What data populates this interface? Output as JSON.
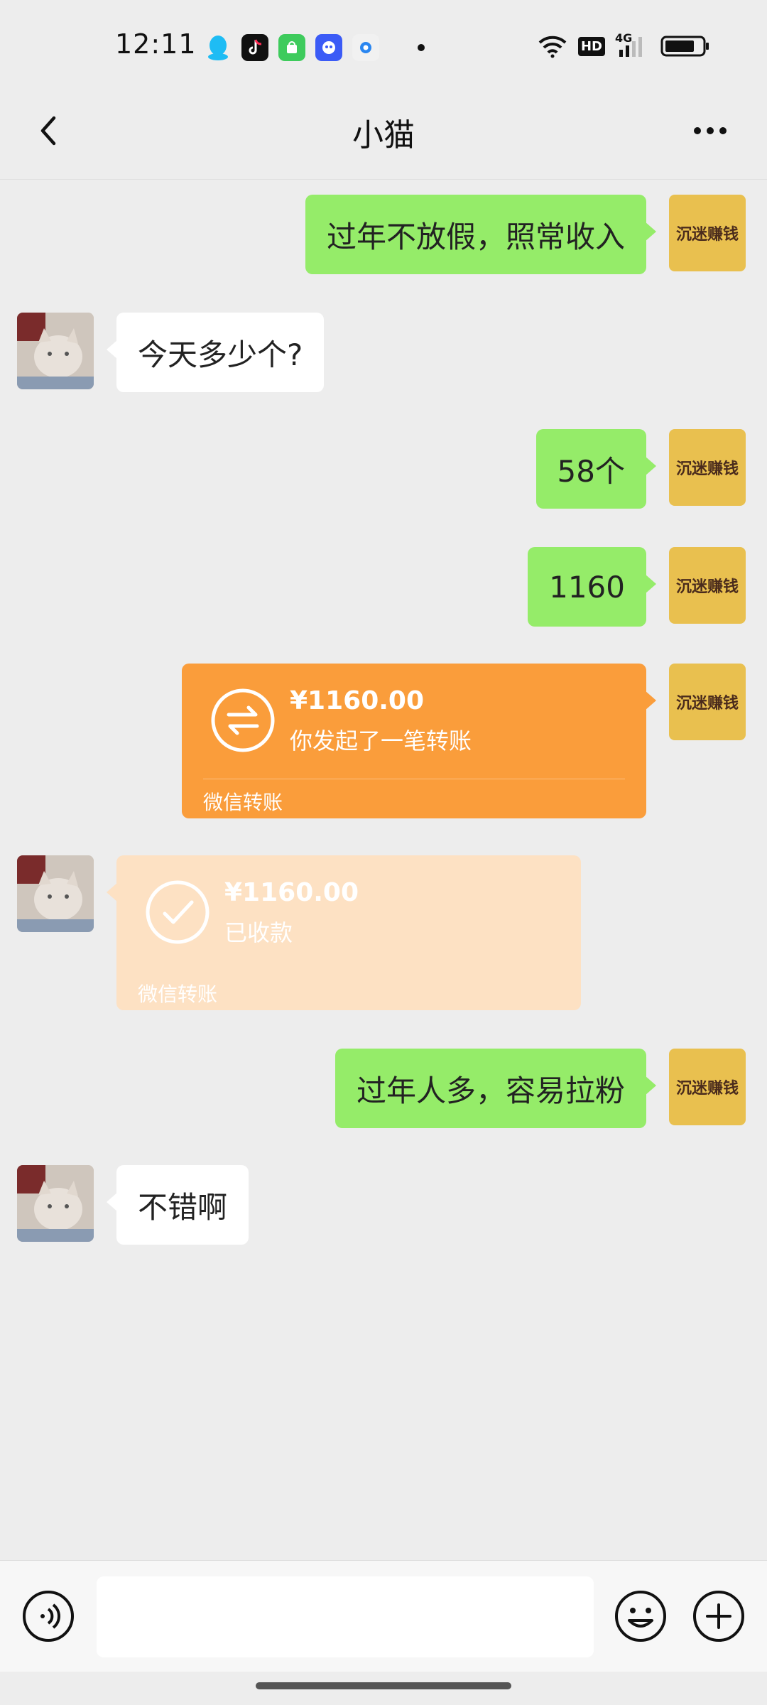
{
  "status_bar": {
    "time": "12:11",
    "network": "4G",
    "hd_label": "HD"
  },
  "nav": {
    "title": "小猫",
    "back_icon": "chevron-left-icon",
    "more_icon": "more-dots-icon"
  },
  "avatars": {
    "me_text": "沉迷赚钱",
    "peer_desc_icon": "cat-avatar"
  },
  "messages": [
    {
      "from": "me",
      "type": "text",
      "text": "过年不放假，照常收入"
    },
    {
      "from": "peer",
      "type": "text",
      "text": "今天多少个?"
    },
    {
      "from": "me",
      "type": "text",
      "text": "58个"
    },
    {
      "from": "me",
      "type": "text",
      "text": "1160"
    },
    {
      "from": "me",
      "type": "transfer",
      "amount": "¥1160.00",
      "status": "你发起了一笔转账",
      "footer": "微信转账"
    },
    {
      "from": "peer",
      "type": "transfer",
      "amount": "¥1160.00",
      "status": "已收款",
      "footer": "微信转账"
    },
    {
      "from": "me",
      "type": "text",
      "text": "过年人多，容易拉粉"
    },
    {
      "from": "peer",
      "type": "text",
      "text": "不错啊"
    }
  ],
  "input_bar": {
    "voice_icon": "voice-icon",
    "emoji_icon": "emoji-icon",
    "plus_icon": "plus-icon",
    "input_value": ""
  },
  "colors": {
    "my_bubble": "#95ec69",
    "peer_bubble": "#ffffff",
    "transfer_sent": "#fa9d3b",
    "transfer_received": "#fde1c3",
    "background": "#ededed"
  }
}
